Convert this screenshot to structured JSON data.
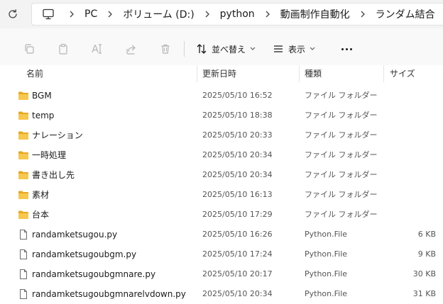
{
  "breadcrumb": {
    "items": [
      {
        "label": "PC"
      },
      {
        "label": "ボリューム (D:)"
      },
      {
        "label": "python"
      },
      {
        "label": "動画制作自動化"
      },
      {
        "label": "ランダム結合"
      }
    ]
  },
  "toolbar": {
    "sort_label": "並べ替え",
    "view_label": "表示"
  },
  "columns": {
    "name": "名前",
    "date": "更新日時",
    "type": "種類",
    "size": "サイズ"
  },
  "files": [
    {
      "icon": "folder-icon",
      "name": "BGM",
      "date": "2025/05/10 16:52",
      "type": "ファイル フォルダー",
      "size": ""
    },
    {
      "icon": "folder-icon",
      "name": "temp",
      "date": "2025/05/10 18:38",
      "type": "ファイル フォルダー",
      "size": ""
    },
    {
      "icon": "folder-icon",
      "name": "ナレーション",
      "date": "2025/05/10 20:33",
      "type": "ファイル フォルダー",
      "size": ""
    },
    {
      "icon": "folder-icon",
      "name": "一時処理",
      "date": "2025/05/10 20:34",
      "type": "ファイル フォルダー",
      "size": ""
    },
    {
      "icon": "folder-icon",
      "name": "書き出し先",
      "date": "2025/05/10 20:34",
      "type": "ファイル フォルダー",
      "size": ""
    },
    {
      "icon": "folder-icon",
      "name": "素材",
      "date": "2025/05/10 16:13",
      "type": "ファイル フォルダー",
      "size": ""
    },
    {
      "icon": "folder-icon",
      "name": "台本",
      "date": "2025/05/10 17:29",
      "type": "ファイル フォルダー",
      "size": ""
    },
    {
      "icon": "file-icon",
      "name": "randamketsugou.py",
      "date": "2025/05/10 16:26",
      "type": "Python.File",
      "size": "6 KB"
    },
    {
      "icon": "file-icon",
      "name": "randamketsugoubgm.py",
      "date": "2025/05/10 17:24",
      "type": "Python.File",
      "size": "9 KB"
    },
    {
      "icon": "file-icon",
      "name": "randamketsugoubgmnare.py",
      "date": "2025/05/10 20:17",
      "type": "Python.File",
      "size": "30 KB"
    },
    {
      "icon": "file-icon",
      "name": "randamketsugoubgmnarelvdown.py",
      "date": "2025/05/10 20:34",
      "type": "Python.File",
      "size": "31 KB"
    }
  ],
  "colors": {
    "folder": "#f5c348",
    "folder_dark": "#e6a823",
    "accent": "#1b1b1b"
  }
}
